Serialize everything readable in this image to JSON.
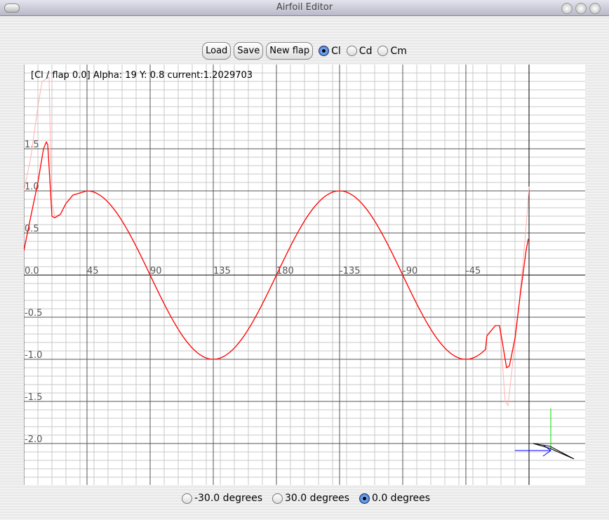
{
  "window": {
    "title": "Airfoil Editor"
  },
  "toolbar": {
    "load": "Load",
    "save": "Save",
    "new_flap": "New flap",
    "options": [
      {
        "label": "Cl",
        "selected": true
      },
      {
        "label": "Cd",
        "selected": false
      },
      {
        "label": "Cm",
        "selected": false
      }
    ]
  },
  "status": "[Cl / flap 0.0] Alpha: 19 Y: 0.8 current:1.2029703",
  "flap_options": [
    {
      "label": "-30.0 degrees",
      "selected": false
    },
    {
      "label": "30.0 degrees",
      "selected": false
    },
    {
      "label": "0.0 degrees",
      "selected": true
    }
  ],
  "chart_data": {
    "type": "line",
    "x_tick_labels": [
      "45",
      "90",
      "135",
      "180",
      "-135",
      "-90",
      "-45"
    ],
    "x_tick_values": [
      45,
      90,
      135,
      180,
      225,
      270,
      315
    ],
    "y_tick_labels": [
      "1.5",
      "1.0",
      "0.5",
      "0.0",
      "-0.5",
      "-1.0",
      "-1.5",
      "-2.0"
    ],
    "y_tick_values": [
      1.5,
      1.0,
      0.5,
      0.0,
      -0.5,
      -1.0,
      -1.5,
      -2.0
    ],
    "xlim": [
      0,
      400
    ],
    "ylim": [
      -2.5,
      2.5
    ],
    "grid": true,
    "series": [
      {
        "color": "#ff0000",
        "points": [
          [
            0,
            0.29
          ],
          [
            5,
            0.7
          ],
          [
            10,
            1.1
          ],
          [
            14,
            1.5
          ],
          [
            16,
            1.58
          ],
          [
            17,
            1.55
          ],
          [
            19,
            1.0
          ],
          [
            20,
            0.7
          ],
          [
            22,
            0.68
          ],
          [
            26,
            0.72
          ],
          [
            30,
            0.85
          ],
          [
            35,
            0.95
          ],
          [
            45,
            1.0
          ],
          "sin2a",
          [
            330,
            -0.72
          ],
          [
            336,
            -0.6
          ],
          [
            339,
            -0.6
          ],
          [
            340,
            -0.7
          ],
          [
            344,
            -1.1
          ],
          [
            346,
            -1.08
          ],
          [
            350,
            -0.75
          ],
          [
            354,
            -0.2
          ],
          [
            358,
            0.3
          ],
          [
            359.5,
            0.43
          ]
        ]
      },
      {
        "color": "#ffb0b0",
        "points": [
          [
            0,
            1.0
          ],
          [
            5,
            1.4
          ],
          [
            10,
            2.0
          ],
          [
            13,
            2.3
          ],
          [
            18,
            2.35
          ],
          [
            19,
            1.5
          ],
          [
            20,
            0.85
          ],
          [
            22,
            0.7
          ],
          [
            26,
            0.72
          ],
          [
            30,
            0.85
          ],
          [
            35,
            0.95
          ],
          [
            45,
            1.0
          ],
          "sin2a",
          [
            330,
            -0.72
          ],
          [
            336,
            -0.6
          ],
          [
            339,
            -0.6
          ],
          [
            340,
            -0.8
          ],
          [
            343,
            -1.5
          ],
          [
            345,
            -1.55
          ],
          [
            348,
            -1.1
          ],
          [
            352,
            -0.5
          ],
          [
            356,
            0.2
          ],
          [
            359,
            0.8
          ],
          [
            360,
            1.05
          ]
        ]
      }
    ]
  }
}
